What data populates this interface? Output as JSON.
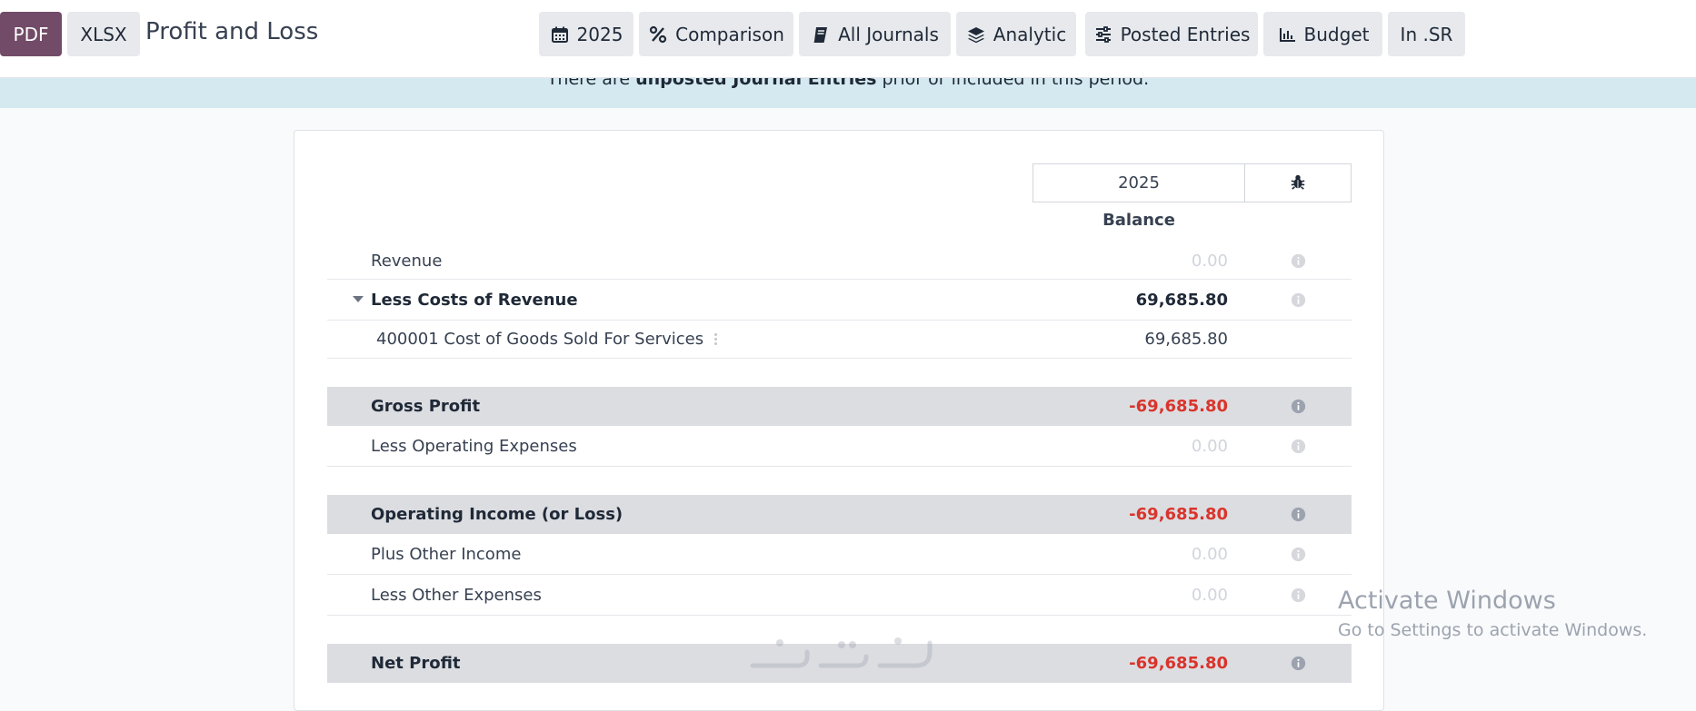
{
  "toolbar": {
    "pdf_label": "PDF",
    "xlsx_label": "XLSX",
    "title": "Profit and Loss",
    "filters": [
      {
        "label": "2025",
        "icon": "calendar-icon"
      },
      {
        "label": "Comparison",
        "icon": "percent-icon"
      },
      {
        "label": "All Journals",
        "icon": "book-icon"
      },
      {
        "label": "Analytic",
        "icon": "layers-icon"
      },
      {
        "label": "Posted Entries",
        "icon": "sliders-icon"
      },
      {
        "label": "Budget",
        "icon": "bar-chart-icon"
      },
      {
        "label": "In .SR",
        "icon": ""
      }
    ]
  },
  "banner": {
    "prefix": "There are",
    "bold": "unposted Journal Entries",
    "suffix": "prior or included in this period."
  },
  "report": {
    "column_year": "2025",
    "column_balance": "Balance",
    "rows": [
      {
        "label": "Revenue",
        "value": "0.00"
      },
      {
        "label": "Less Costs of Revenue",
        "value": "69,685.80"
      },
      {
        "label": "400001 Cost of Goods Sold For Services",
        "value": "69,685.80"
      },
      {
        "label": "Gross Profit",
        "value": "-69,685.80"
      },
      {
        "label": "Less Operating Expenses",
        "value": "0.00"
      },
      {
        "label": "Operating Income (or Loss)",
        "value": "-69,685.80"
      },
      {
        "label": "Plus Other Income",
        "value": "0.00"
      },
      {
        "label": "Less Other Expenses",
        "value": "0.00"
      },
      {
        "label": "Net Profit",
        "value": "-69,685.80"
      }
    ]
  },
  "os_overlay": {
    "line1": "Activate Windows",
    "line2": "Go to Settings to activate Windows."
  },
  "colors": {
    "primary": "#714b67",
    "negative": "#d9342b",
    "banner": "#d4eaf0",
    "total_row": "#dcdde1"
  }
}
